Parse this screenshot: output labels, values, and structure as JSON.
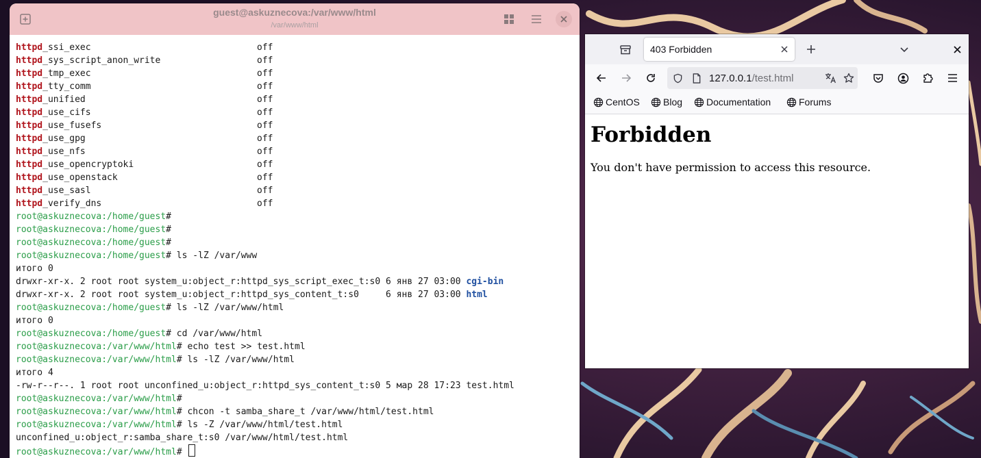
{
  "terminal": {
    "title": "guest@askuznecova:/var/www/html",
    "subtitle": "/var/www/html",
    "booleans": [
      {
        "prefix": "httpd",
        "name": "_ssi_exec",
        "value": "off"
      },
      {
        "prefix": "httpd",
        "name": "_sys_script_anon_write",
        "value": "off"
      },
      {
        "prefix": "httpd",
        "name": "_tmp_exec",
        "value": "off"
      },
      {
        "prefix": "httpd",
        "name": "_tty_comm",
        "value": "off"
      },
      {
        "prefix": "httpd",
        "name": "_unified",
        "value": "off"
      },
      {
        "prefix": "httpd",
        "name": "_use_cifs",
        "value": "off"
      },
      {
        "prefix": "httpd",
        "name": "_use_fusefs",
        "value": "off"
      },
      {
        "prefix": "httpd",
        "name": "_use_gpg",
        "value": "off"
      },
      {
        "prefix": "httpd",
        "name": "_use_nfs",
        "value": "off"
      },
      {
        "prefix": "httpd",
        "name": "_use_opencryptoki",
        "value": "off"
      },
      {
        "prefix": "httpd",
        "name": "_use_openstack",
        "value": "off"
      },
      {
        "prefix": "httpd",
        "name": "_use_sasl",
        "value": "off"
      },
      {
        "prefix": "httpd",
        "name": "_verify_dns",
        "value": "off"
      }
    ],
    "session": [
      {
        "type": "prompt",
        "user": "root@askuznecova",
        "path": ":/home/guest",
        "cmd": "#"
      },
      {
        "type": "prompt",
        "user": "root@askuznecova",
        "path": ":/home/guest",
        "cmd": "#"
      },
      {
        "type": "prompt",
        "user": "root@askuznecova",
        "path": ":/home/guest",
        "cmd": "#"
      },
      {
        "type": "prompt",
        "user": "root@askuznecova",
        "path": ":/home/guest",
        "cmd": "# ls -lZ /var/www"
      },
      {
        "type": "out",
        "text": "итого 0"
      },
      {
        "type": "dir",
        "text": "drwxr-xr-x. 2 root root system_u:object_r:httpd_sys_script_exec_t:s0 6 янв 27 03:00 ",
        "name": "cgi-bin"
      },
      {
        "type": "dir",
        "text": "drwxr-xr-x. 2 root root system_u:object_r:httpd_sys_content_t:s0     6 янв 27 03:00 ",
        "name": "html"
      },
      {
        "type": "prompt",
        "user": "root@askuznecova",
        "path": ":/home/guest",
        "cmd": "# ls -lZ /var/www/html"
      },
      {
        "type": "out",
        "text": "итого 0"
      },
      {
        "type": "prompt",
        "user": "root@askuznecova",
        "path": ":/home/guest",
        "cmd": "# cd /var/www/html"
      },
      {
        "type": "prompt",
        "user": "root@askuznecova",
        "path": ":/var/www/html",
        "cmd": "# echo test >> test.html"
      },
      {
        "type": "prompt",
        "user": "root@askuznecova",
        "path": ":/var/www/html",
        "cmd": "# ls -lZ /var/www/html"
      },
      {
        "type": "out",
        "text": "итого 4"
      },
      {
        "type": "out",
        "text": "-rw-r--r--. 1 root root unconfined_u:object_r:httpd_sys_content_t:s0 5 мар 28 17:23 test.html"
      },
      {
        "type": "prompt",
        "user": "root@askuznecova",
        "path": ":/var/www/html",
        "cmd": "#"
      },
      {
        "type": "prompt",
        "user": "root@askuznecova",
        "path": ":/var/www/html",
        "cmd": "# chcon -t samba_share_t /var/www/html/test.html"
      },
      {
        "type": "prompt",
        "user": "root@askuznecova",
        "path": ":/var/www/html",
        "cmd": "# ls -Z /var/www/html/test.html"
      },
      {
        "type": "out",
        "text": "unconfined_u:object_r:samba_share_t:s0 /var/www/html/test.html"
      },
      {
        "type": "prompt_cursor",
        "user": "root@askuznecova",
        "path": ":/var/www/html",
        "cmd": "# "
      }
    ],
    "icons": {
      "new_tab": "new-tab-icon",
      "view": "grid-view-icon",
      "menu": "hamburger-menu-icon",
      "close": "close-icon"
    }
  },
  "browser": {
    "tab_title": "403 Forbidden",
    "url_host": "127.0.0.1",
    "url_path": "/test.html",
    "bookmarks": [
      "CentOS",
      "Blog",
      "Documentation",
      "Forums"
    ],
    "page": {
      "heading": "Forbidden",
      "message": "You don't have permission to access this resource."
    }
  },
  "colors": {
    "terminal_header": "#f0c4c7",
    "bold_red": "#b0141c",
    "prompt_green": "#2a9d48",
    "dir_blue": "#1f4fa0"
  }
}
